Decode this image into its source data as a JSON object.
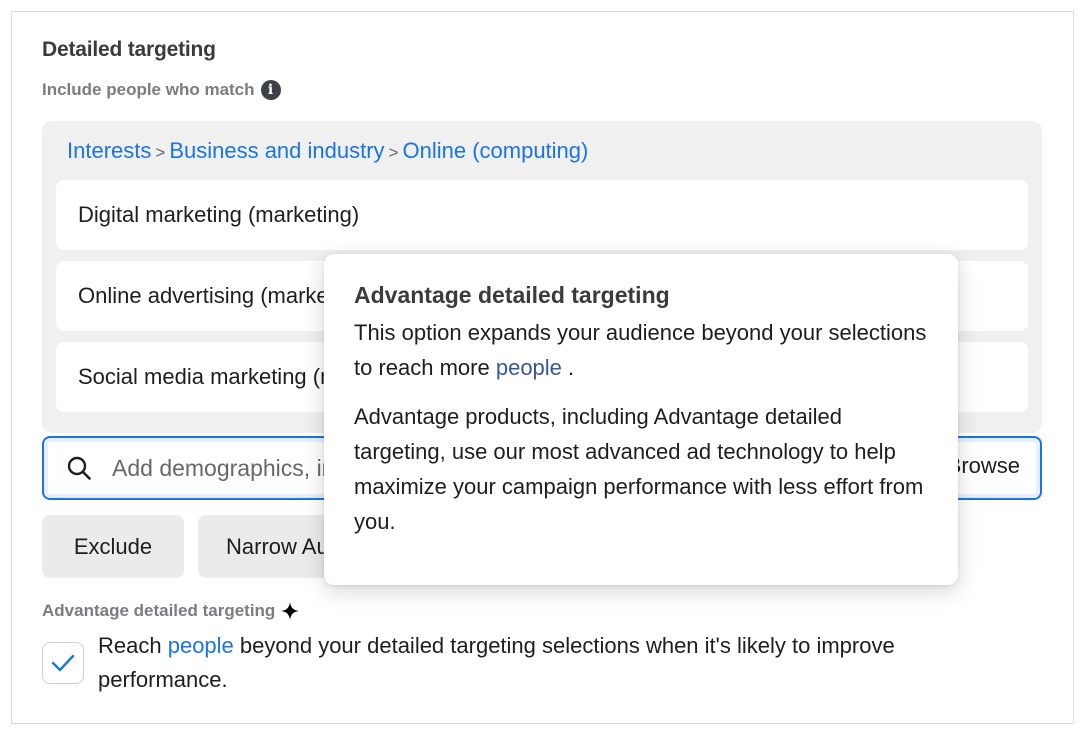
{
  "section": {
    "title": "Detailed targeting",
    "include_label": "Include people who match",
    "info_icon": "info-icon"
  },
  "breadcrumb": {
    "items": [
      "Interests",
      "Business and industry",
      "Online (computing)"
    ],
    "separator": ">"
  },
  "selected_items": [
    {
      "label": "Digital marketing (marketing)"
    },
    {
      "label": "Online advertising (marketing)"
    },
    {
      "label": "Social media marketing (marketing)"
    }
  ],
  "search": {
    "placeholder": "Add demographics, interests or behaviors",
    "value": "",
    "browse_label": "Browse",
    "icon": "search-icon"
  },
  "buttons": {
    "exclude": "Exclude",
    "narrow": "Narrow Audience"
  },
  "advantage": {
    "label": "Advantage detailed targeting",
    "icon": "sparkle-icon",
    "checkbox_checked": true,
    "text_before": "Reach ",
    "link_text": "people",
    "text_after": " beyond your detailed targeting selections when it's likely to improve performance."
  },
  "tooltip": {
    "title": "Advantage detailed targeting",
    "p1_before": "This option expands your audience beyond your selections to reach more ",
    "p1_link": "people",
    "p1_after": " .",
    "p2": "Advantage products, including Advantage detailed targeting, use our most advanced ad technology to help maximize your campaign performance with less effort from you."
  },
  "colors": {
    "accent": "#1b74e4",
    "tooltip_link": "#385898",
    "label_gray": "#7a7c80",
    "box_bg": "#f0f0f0"
  }
}
